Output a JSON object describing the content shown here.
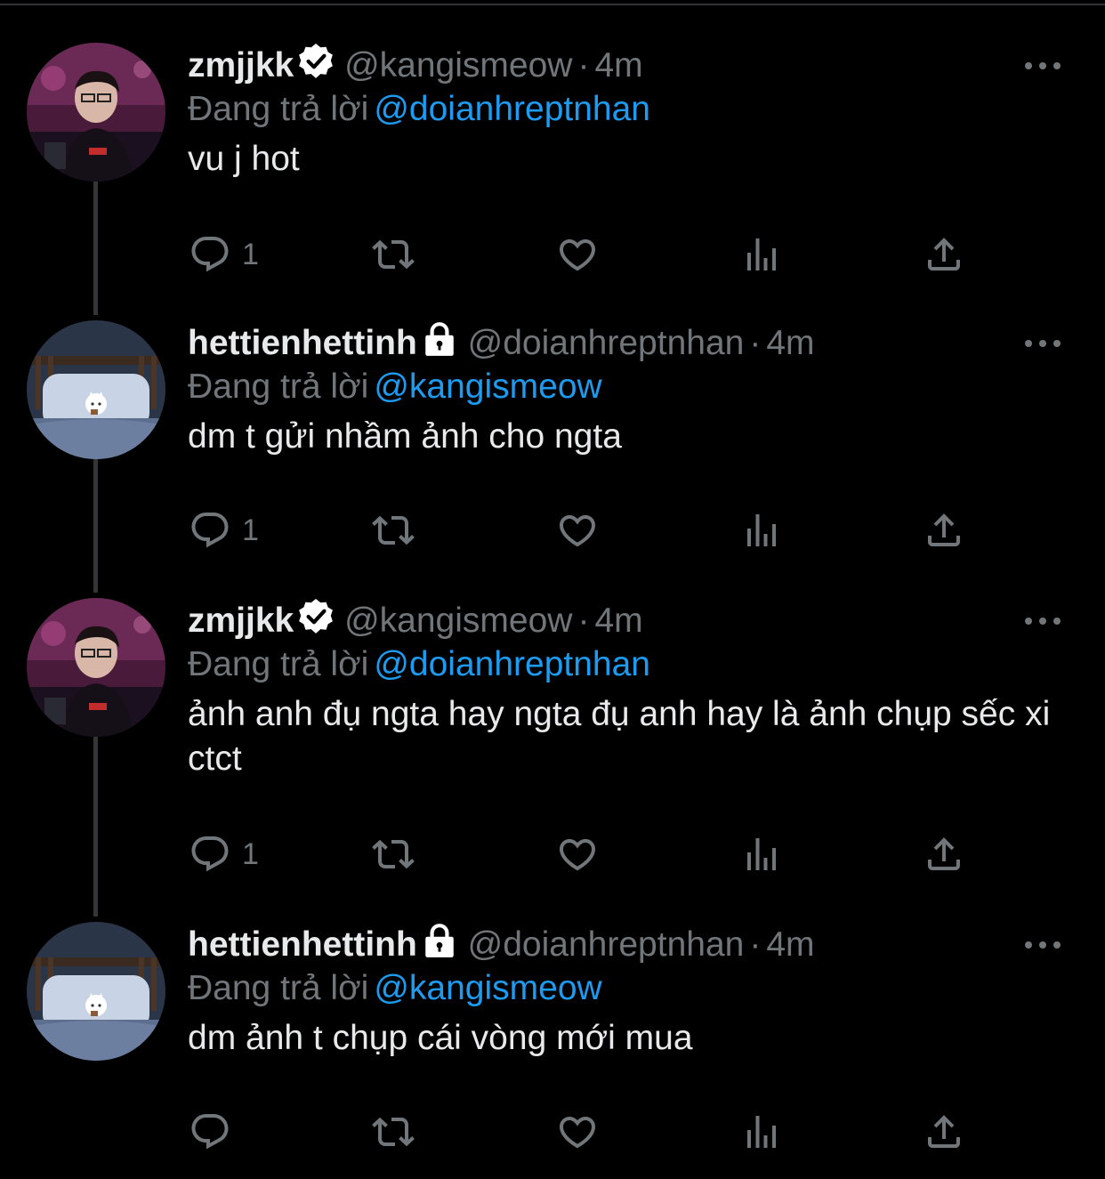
{
  "colors": {
    "background": "#000000",
    "text": "#e7e9ea",
    "muted": "#71767b",
    "mention": "#1d9bf0"
  },
  "reply_prefix": "Đang trả lời",
  "tweets": [
    {
      "name": "zmjjkk",
      "badge": "verified-icon",
      "handle": "@kangismeow",
      "separator": "·",
      "time": "4m",
      "reply_to": "@doianhreptnhan",
      "text": "vu j hot",
      "reply_count": "1",
      "retweet_count": "",
      "like_count": ""
    },
    {
      "name": "hettienhettinh",
      "badge": "lock-icon",
      "handle": "@doianhreptnhan",
      "separator": "·",
      "time": "4m",
      "reply_to": "@kangismeow",
      "text": "dm t gửi nhầm ảnh cho ngta",
      "reply_count": "1",
      "retweet_count": "",
      "like_count": ""
    },
    {
      "name": "zmjjkk",
      "badge": "verified-icon",
      "handle": "@kangismeow",
      "separator": "·",
      "time": "4m",
      "reply_to": "@doianhreptnhan",
      "text": "ảnh anh đụ ngta hay ngta đụ anh hay là ảnh chụp sếc xi ctct",
      "reply_count": "1",
      "retweet_count": "",
      "like_count": ""
    },
    {
      "name": "hettienhettinh",
      "badge": "lock-icon",
      "handle": "@doianhreptnhan",
      "separator": "·",
      "time": "4m",
      "reply_to": "@kangismeow",
      "text": "dm ảnh t chụp cái vòng mới mua",
      "reply_count": "",
      "retweet_count": "",
      "like_count": ""
    }
  ]
}
